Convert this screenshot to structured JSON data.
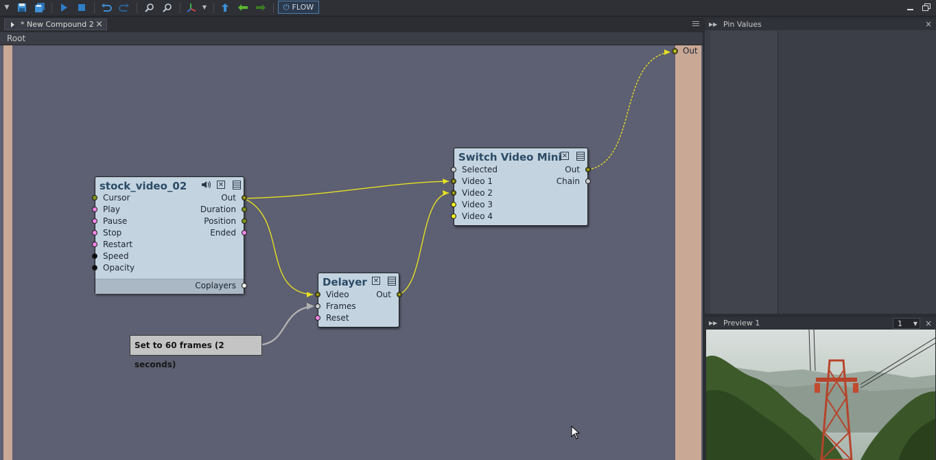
{
  "toolbar": {
    "flow_label": "FLOW"
  },
  "tab": {
    "label": "* New Compound 2",
    "close": "×"
  },
  "breadcrumb": "Root",
  "canvas": {
    "out_label": "Out",
    "nodes": {
      "stock": {
        "title": "stock_video_02",
        "inputs": [
          "Cursor",
          "Play",
          "Pause",
          "Stop",
          "Restart",
          "Speed",
          "Opacity"
        ],
        "outputs": [
          "Out",
          "Duration",
          "Position",
          "Ended"
        ],
        "footer_pin": "Coplayers"
      },
      "delayer": {
        "title": "Delayer",
        "inputs": [
          "Video",
          "Frames",
          "Reset"
        ],
        "outputs": [
          "Out"
        ]
      },
      "switch": {
        "title": "Switch Video Mini",
        "inputs": [
          "Selected",
          "Video 1",
          "Video 2",
          "Video 3",
          "Video 4"
        ],
        "outputs": [
          "Out",
          "Chain"
        ]
      }
    },
    "comment": "Set to 60 frames (2 seconds)"
  },
  "pin_panel": {
    "title": "Pin Values"
  },
  "preview_panel": {
    "title": "Preview 1",
    "number": "1"
  },
  "colors": {
    "canvas_bg": "#5d5f72",
    "node_bg": "#c3d4e0",
    "wire_yellow": "#e6e122",
    "wire_gray": "#b0b0b0",
    "accent": "#4a7fb3"
  }
}
